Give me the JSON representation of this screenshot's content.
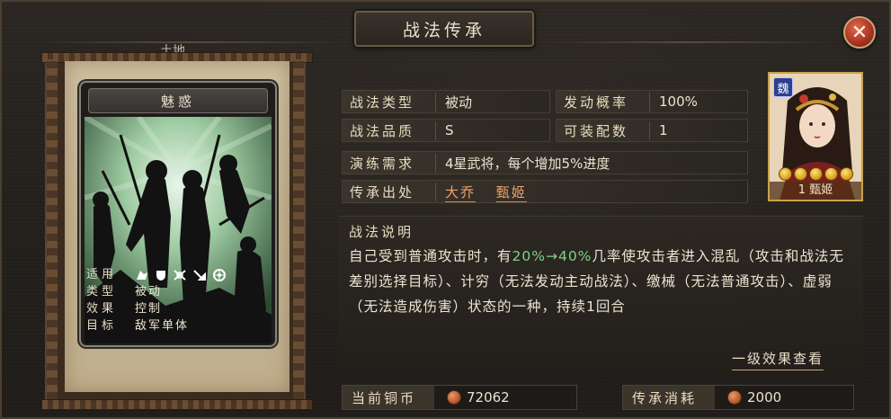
{
  "header": {
    "title": "战法传承",
    "terrain_label": "土地",
    "close_symbol": "✕"
  },
  "skill_card": {
    "name": "魅惑",
    "suitable_label": "适用",
    "suitable_icons": [
      "cavalry-icon",
      "shield-icon",
      "bow-icon",
      "spear-icon",
      "siege-icon"
    ],
    "type_label": "类型",
    "type_value": "被动",
    "effect_label": "效果",
    "effect_value": "控制",
    "target_label": "目标",
    "target_value": "敌军单体"
  },
  "attributes": {
    "type_label": "战法类型",
    "type_value": "被动",
    "rate_label": "发动概率",
    "rate_value": "100%",
    "quality_label": "战法品质",
    "quality_value": "S",
    "equip_label": "可装配数",
    "equip_value": "1",
    "train_label": "演练需求",
    "train_value": "4星武将，每个增加5%进度",
    "source_label": "传承出处",
    "sources": [
      "大乔",
      "甄姬"
    ]
  },
  "description": {
    "title": "战法说明",
    "text_before": "自己受到普通攻击时，有",
    "highlight": "20%→40%",
    "text_after": "几率使攻击者进入混乱（攻击和战法无差别选择目标）、计穷（无法发动主动战法）、缴械（无法普通攻击）、虚弱（无法造成伤害）状态的一种，持续1回合",
    "view_link": "一级效果查看"
  },
  "bottom": {
    "copper_label": "当前铜币",
    "copper_value": "72062",
    "cost_label": "传承消耗",
    "cost_value": "2000"
  },
  "portrait": {
    "faction": "魏",
    "name": "1 甄姬",
    "stars": 5
  },
  "colors": {
    "accent_green": "#7fd386",
    "source_orange": "#f0a36a",
    "close_red": "#a53320"
  }
}
